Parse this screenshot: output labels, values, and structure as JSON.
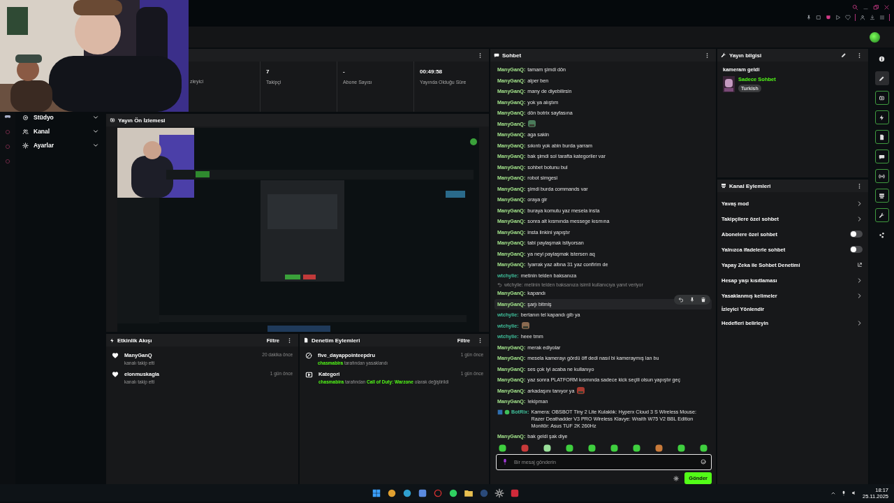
{
  "sidebar": {
    "items": [
      {
        "label": "Stüdyo"
      },
      {
        "label": "Kanal"
      },
      {
        "label": "Ayarlar"
      }
    ]
  },
  "stats": [
    {
      "label": "zleyici"
    },
    {
      "value": "7",
      "label": "Takipçi"
    },
    {
      "value": "-",
      "label": "Abone Sayısı"
    },
    {
      "value": "00:49:58",
      "label": "Yayında Olduğu Süre"
    }
  ],
  "preview": {
    "title": "Yayın Ön İzlemesi"
  },
  "activity_feed": {
    "title": "Etkinlik Akışı",
    "filter": "Filtre",
    "events": [
      {
        "kind": "follow",
        "name": "ManyGanQ",
        "detail": "kanalı takip etti",
        "time": "20 dakika önce"
      },
      {
        "kind": "follow",
        "name": "elonmuskagla",
        "detail": "kanalı takip etti",
        "time": "1 gün önce"
      }
    ]
  },
  "moderation": {
    "title": "Denetim Eylemleri",
    "filter": "Filtre",
    "events": [
      {
        "kind": "ban",
        "name": "five_dayappointeepdru",
        "detail": "**chasmabira** tarafından yasaklandı",
        "time": "1 gün önce"
      },
      {
        "kind": "category",
        "name": "Kategori",
        "detail": "**chasmabira** tarafından **Call of Duty: Warzone** olarak değiştirildi",
        "time": "1 gün önce"
      }
    ]
  },
  "chat": {
    "title": "Sohbet",
    "messages": [
      {
        "kind": "text",
        "user": "ManyGanQ:",
        "color": "#a3e38b",
        "text": "tamam şimdi dön",
        "highlighted": false
      },
      {
        "kind": "text",
        "user": "ManyGanQ:",
        "color": "#a3e38b",
        "text": "alper ben",
        "highlighted": false
      },
      {
        "kind": "text",
        "user": "ManyGanQ:",
        "color": "#a3e38b",
        "text": "many de diyebilirsin",
        "highlighted": false
      },
      {
        "kind": "text",
        "user": "ManyGanQ:",
        "color": "#a3e38b",
        "text": "yok ya alıştım",
        "highlighted": false
      },
      {
        "kind": "text",
        "user": "ManyGanQ:",
        "color": "#a3e38b",
        "text": "dön botrix sayfasına",
        "highlighted": false
      },
      {
        "kind": "emote",
        "user": "ManyGanQ:",
        "color": "#a3e38b",
        "highlighted": false
      },
      {
        "kind": "text",
        "user": "ManyGanQ:",
        "color": "#a3e38b",
        "text": "aga sakin",
        "highlighted": false
      },
      {
        "kind": "text",
        "user": "ManyGanQ:",
        "color": "#a3e38b",
        "text": "sıkıntı yok abin burda yarram",
        "highlighted": false
      },
      {
        "kind": "text",
        "user": "ManyGanQ:",
        "color": "#a3e38b",
        "text": "bak şimdi sol tarafta kategoriler var",
        "highlighted": false
      },
      {
        "kind": "text",
        "user": "ManyGanQ:",
        "color": "#a3e38b",
        "text": "sohbet botunu bul",
        "highlighted": false
      },
      {
        "kind": "text",
        "user": "ManyGanQ:",
        "color": "#a3e38b",
        "text": "robot simgesi",
        "highlighted": false
      },
      {
        "kind": "text",
        "user": "ManyGanQ:",
        "color": "#a3e38b",
        "text": "şimdi burda commands var",
        "highlighted": false
      },
      {
        "kind": "text",
        "user": "ManyGanQ:",
        "color": "#a3e38b",
        "text": "oraya gir",
        "highlighted": false
      },
      {
        "kind": "text",
        "user": "ManyGanQ:",
        "color": "#a3e38b",
        "text": "buraya komutu yaz mesela insta",
        "highlighted": false
      },
      {
        "kind": "text",
        "user": "ManyGanQ:",
        "color": "#a3e38b",
        "text": "sonra alt kısmında messege kısmına",
        "highlighted": false
      },
      {
        "kind": "text",
        "user": "ManyGanQ:",
        "color": "#a3e38b",
        "text": "insta linkini yapıştır",
        "highlighted": false
      },
      {
        "kind": "text",
        "user": "ManyGanQ:",
        "color": "#a3e38b",
        "text": "tabi paylaşmak istiyorsan",
        "highlighted": false
      },
      {
        "kind": "text",
        "user": "ManyGanQ:",
        "color": "#a3e38b",
        "text": "ya neyi paylaşmak istersen aq",
        "highlighted": false
      },
      {
        "kind": "text",
        "user": "ManyGanQ:",
        "color": "#a3e38b",
        "text": "!yarrak yaz altına 31 yaz confirim de",
        "highlighted": false
      },
      {
        "kind": "text",
        "user": "wtchylie:",
        "color": "#3fbf9a",
        "text": "metinin telden baksanıza",
        "highlighted": false
      },
      {
        "kind": "reply",
        "text": "wtchylie: metinin telden baksanıza isimli kullanıcıya yanıt veriyor",
        "highlighted": false
      },
      {
        "kind": "text",
        "user": "ManyGanQ:",
        "color": "#a3e38b",
        "text": "kapandı",
        "highlighted": false
      },
      {
        "kind": "text",
        "user": "ManyGanQ:",
        "color": "#a3e38b",
        "text": "şarjı bitmiş",
        "highlighted": true
      },
      {
        "kind": "text",
        "user": "wtchylie:",
        "color": "#3fbf9a",
        "text": "bertanın tel kapandı gib ya",
        "highlighted": false
      },
      {
        "kind": "emote",
        "user": "wtchylie:",
        "color": "#3fbf9a",
        "highlighted": false
      },
      {
        "kind": "text",
        "user": "wtchylie:",
        "color": "#3fbf9a",
        "text": "heee tmm",
        "highlighted": false
      },
      {
        "kind": "text",
        "user": "ManyGanQ:",
        "color": "#a3e38b",
        "text": "merak ediyolar",
        "highlighted": false
      },
      {
        "kind": "text",
        "user": "ManyGanQ:",
        "color": "#a3e38b",
        "text": "mesela kamerayı gördü öff dedi nasıl bi kameraymış lan bu",
        "highlighted": false
      },
      {
        "kind": "text",
        "user": "ManyGanQ:",
        "color": "#a3e38b",
        "text": "ses çok iyi acaba ne kullanıyo",
        "highlighted": false
      },
      {
        "kind": "text",
        "user": "ManyGanQ:",
        "color": "#a3e38b",
        "text": "yaz sonra PLATFORM kısmında sadece kick seçili olsun yapıştır geç",
        "highlighted": false
      },
      {
        "kind": "mixed",
        "user": "ManyGanQ:",
        "color": "#a3e38b",
        "text": "arkadaşını tanıyor ya",
        "highlighted": false
      },
      {
        "kind": "text",
        "user": "ManyGanQ:",
        "color": "#a3e38b",
        "text": "!ekipman",
        "highlighted": false
      },
      {
        "kind": "bot",
        "user": "BotRix:",
        "color": "#3fbf9a",
        "text": "Kamera: OBSBOT Tiny 2 Lite Kulaklık: Hyperx Cloud 3 S Wireless Mouse: Razer Deathadder V3 PRO Wireless Klavye: Wraith W75 V2 BBL Edition Monitör: Asus TUF 2K 260Hz",
        "highlighted": false
      },
      {
        "kind": "text",
        "user": "ManyGanQ:",
        "color": "#a3e38b",
        "text": "bak geldi şak diye",
        "highlighted": false
      }
    ],
    "input": {
      "placeholder": "Bir mesaj gönderin"
    },
    "send": "Gönder"
  },
  "stream_info": {
    "title": "Yayın bilgisi",
    "stream_title": "kameram geldi",
    "category": "Sadece Sohbet",
    "tag": "Turkish"
  },
  "channel_actions": {
    "title": "Kanal Eylemleri",
    "items": [
      {
        "kind": "submenu",
        "label": "Yavaş mod"
      },
      {
        "kind": "submenu",
        "label": "Takipçilere özel sohbet"
      },
      {
        "kind": "toggle",
        "label": "Abonelere özel sohbet",
        "on": false
      },
      {
        "kind": "toggle",
        "label": "Yalnızca ifadelerle sohbet",
        "on": false
      },
      {
        "kind": "external",
        "label": "Yapay Zeka ile Sohbet Denetimi"
      },
      {
        "kind": "submenu",
        "label": "Hesap yaşı kısıtlaması"
      },
      {
        "kind": "submenu",
        "label": "Yasaklanmış kelimeler"
      },
      {
        "kind": "plain",
        "label": "İzleyici Yönlendir"
      },
      {
        "kind": "submenu",
        "label": "Hedefleri belirleyin"
      }
    ]
  },
  "icon_rail": [
    {
      "kind": "info",
      "framed": false,
      "selected": false
    },
    {
      "kind": "edit",
      "framed": false,
      "selected": true
    },
    {
      "kind": "capture",
      "framed": true,
      "selected": false
    },
    {
      "kind": "bolt",
      "framed": true,
      "selected": false
    },
    {
      "kind": "doc",
      "framed": true,
      "selected": false
    },
    {
      "kind": "chat",
      "framed": true,
      "selected": false
    },
    {
      "kind": "broadcast",
      "framed": true,
      "selected": false
    },
    {
      "kind": "layout",
      "framed": true,
      "selected": false
    },
    {
      "kind": "wrench",
      "framed": true,
      "selected": false
    },
    {
      "kind": "nodes",
      "framed": false,
      "selected": false
    }
  ],
  "taskbar": {
    "time": "18:17",
    "date": "25.11.2025"
  }
}
